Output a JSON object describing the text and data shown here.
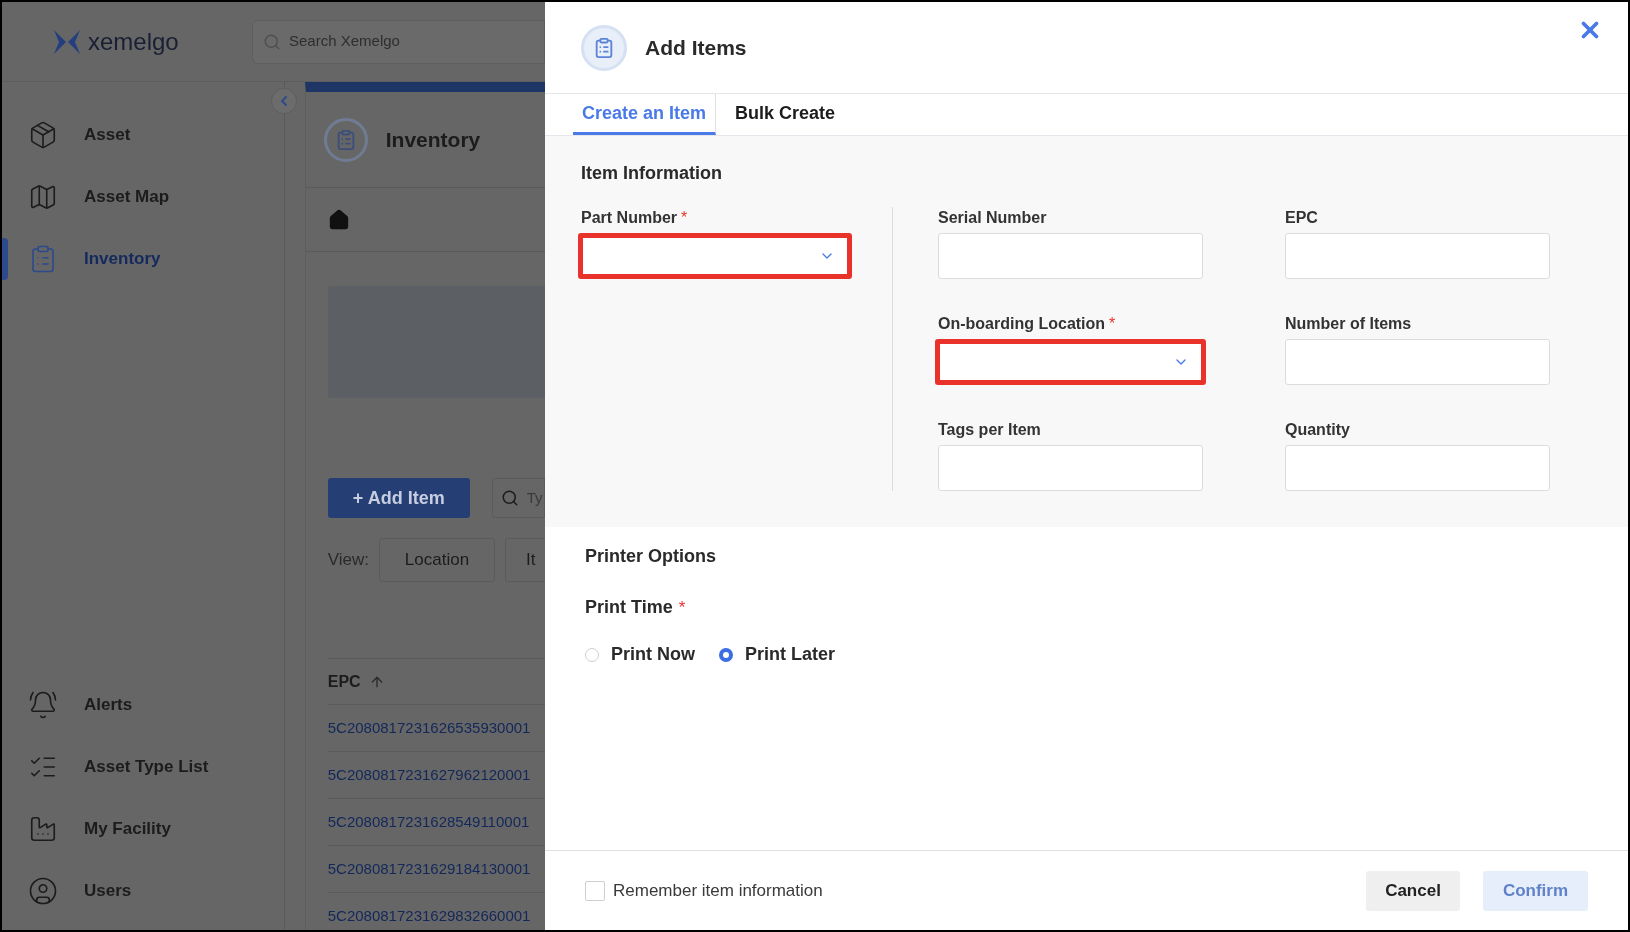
{
  "app": {
    "logo": "xemelgo",
    "search": {
      "placeholder": "Search Xemelgo"
    }
  },
  "sidebar": {
    "top_items": [
      {
        "label": "Asset",
        "selected": false
      },
      {
        "label": "Asset Map",
        "selected": false
      },
      {
        "label": "Inventory",
        "selected": true
      }
    ],
    "bottom_items": [
      {
        "label": "Alerts",
        "selected": false
      },
      {
        "label": "Asset Type List",
        "selected": false
      },
      {
        "label": "My Facility",
        "selected": false
      },
      {
        "label": "Users",
        "selected": false
      }
    ]
  },
  "page": {
    "title": "Inventory",
    "add_button": "+ Add Item",
    "search": {
      "placeholder": "Ty"
    },
    "view_label": "View:",
    "view_options": [
      "Location",
      "It"
    ],
    "table": {
      "columns": [
        "EPC"
      ],
      "rows": [
        "5C2080817231626535930001",
        "5C2080817231627962120001",
        "5C2080817231628549110001",
        "5C2080817231629184130001",
        "5C2080817231629832660001"
      ]
    }
  },
  "modal": {
    "title": "Add Items",
    "tabs": [
      {
        "label": "Create an Item",
        "selected": true
      },
      {
        "label": "Bulk Create",
        "selected": false
      }
    ],
    "section_title": "Item Information",
    "left_fields": [
      {
        "label": "Part Number",
        "required_mark": "*",
        "kind": "dropdown",
        "highlighted": true
      }
    ],
    "right_fields": [
      {
        "label": "Serial Number",
        "kind": "text",
        "highlighted": false
      },
      {
        "label": "EPC",
        "kind": "text",
        "highlighted": false
      },
      {
        "label": "On-boarding Location",
        "required_mark": "*",
        "kind": "dropdown",
        "highlighted": true
      },
      {
        "label": "Number of Items",
        "kind": "text",
        "highlighted": false
      },
      {
        "label": "Tags per Item",
        "kind": "text",
        "highlighted": false
      },
      {
        "label": "Quantity",
        "kind": "text",
        "highlighted": false
      }
    ],
    "printer": {
      "title": "Printer Options",
      "print_time": {
        "label": "Print Time",
        "required_mark": "*",
        "options": [
          {
            "label": "Print Now",
            "selected": false
          },
          {
            "label": "Print Later",
            "selected": true
          }
        ]
      }
    },
    "footer": {
      "remember": {
        "label": "Remember item information",
        "checked": false
      },
      "buttons": [
        {
          "label": "Cancel",
          "disabled": false
        },
        {
          "label": "Confirm",
          "disabled": true
        }
      ]
    }
  }
}
